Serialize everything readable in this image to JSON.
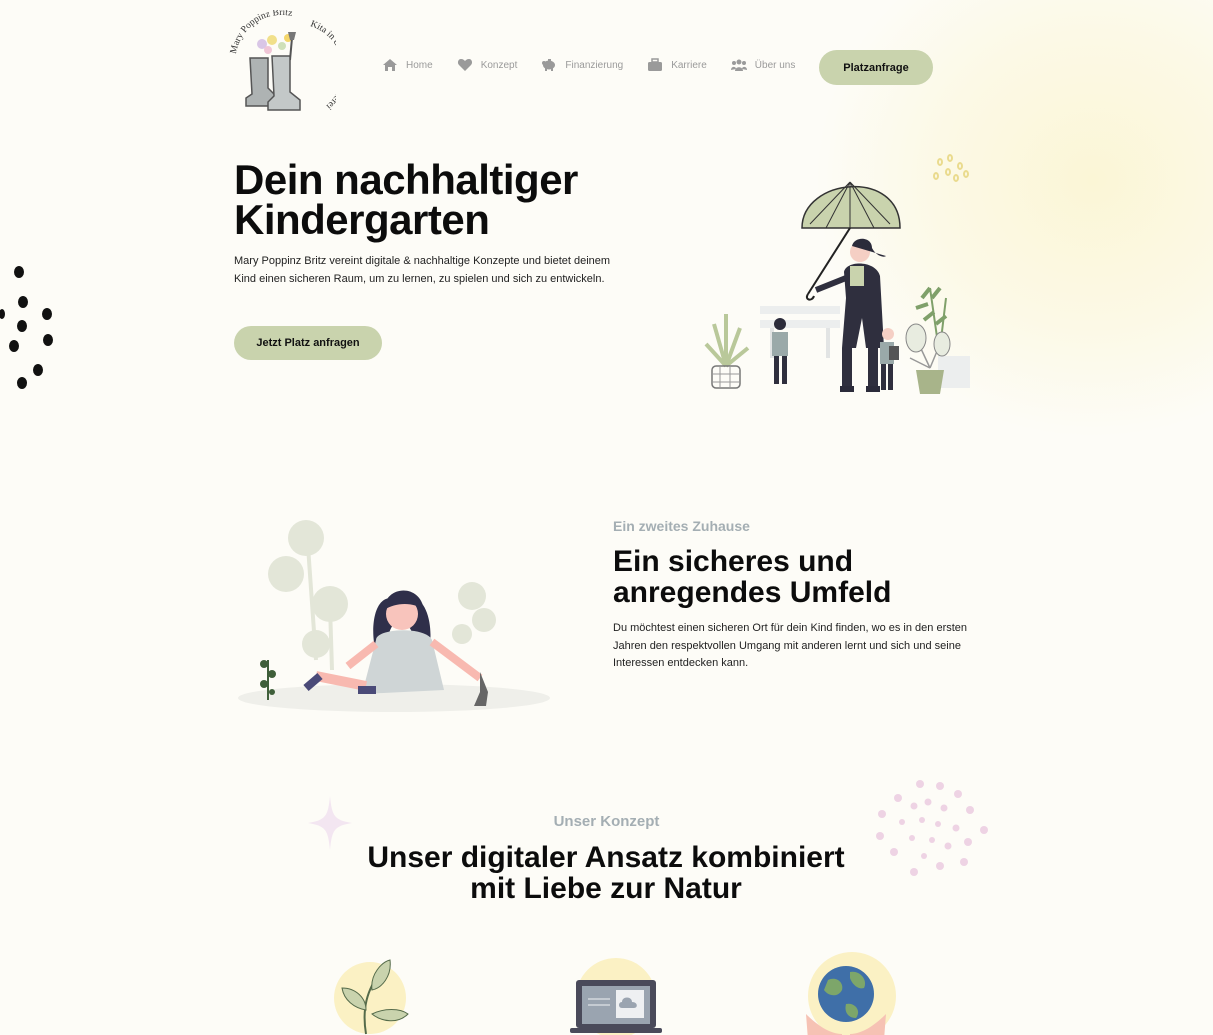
{
  "logo": {
    "text_top": "Mary Poppinz Britz",
    "text_side": "Kita in der alten Gärtnerei"
  },
  "nav": {
    "items": [
      {
        "label": "Home",
        "icon": "home-icon"
      },
      {
        "label": "Konzept",
        "icon": "heart-icon"
      },
      {
        "label": "Finanzierung",
        "icon": "piggy-bank-icon"
      },
      {
        "label": "Karriere",
        "icon": "briefcase-icon"
      },
      {
        "label": "Über uns",
        "icon": "users-icon"
      }
    ],
    "cta": "Platzanfrage"
  },
  "hero": {
    "title_line1": "Dein nachhaltiger",
    "title_line2": "Kindergarten",
    "text": "Mary Poppinz Britz vereint digitale & nachhaltige Konzepte und bietet deinem Kind einen sicheren Raum, um zu lernen, zu spielen und sich zu entwickeln.",
    "cta": "Jetzt Platz anfragen"
  },
  "section2": {
    "kicker": "Ein zweites Zuhause",
    "title_line1": "Ein sicheres und",
    "title_line2": "anregendes Umfeld",
    "text": "Du möchtest einen sicheren Ort für dein Kind finden, wo es in den ersten Jahren den respektvollen Umgang mit anderen lernt und sich und seine Interessen entdecken kann."
  },
  "section3": {
    "kicker": "Unser Konzept",
    "title_line1": "Unser digitaler Ansatz kombiniert",
    "title_line2": "mit Liebe zur Natur"
  },
  "colors": {
    "accent": "#c9d3ad",
    "kicker": "#a4aeb3",
    "background": "#fdfcf7"
  }
}
